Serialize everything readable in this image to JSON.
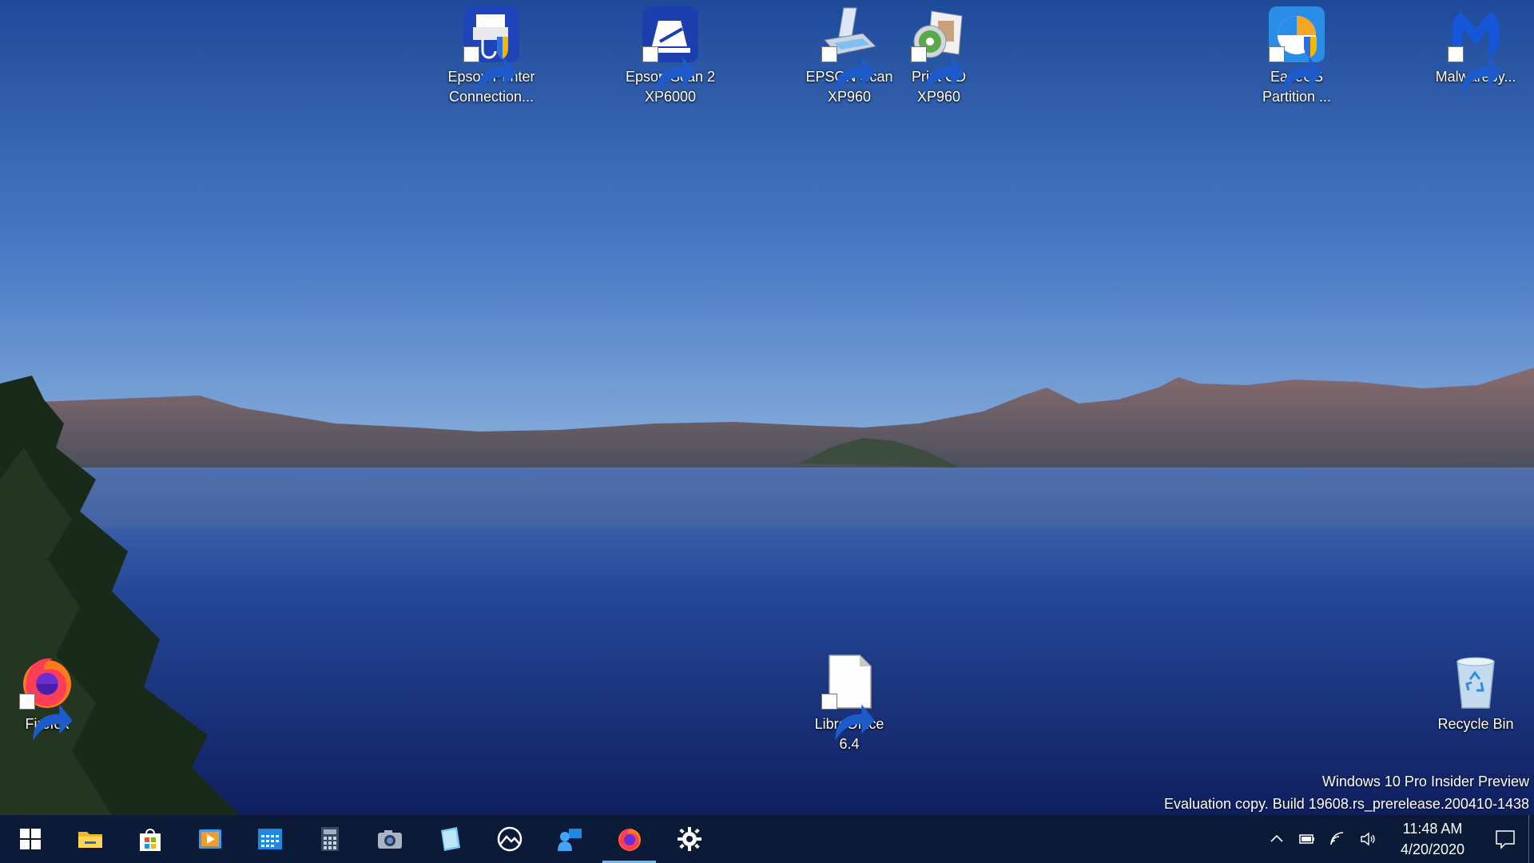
{
  "desktop_icons": {
    "epson_printer": {
      "label": "Epson Printer\nConnection...",
      "icon": "epson-printer-connection-icon"
    },
    "epson_scan2": {
      "label": "Epson Scan 2\nXP6000",
      "icon": "epson-scan2-icon"
    },
    "epson_scan": {
      "label": "EPSON Scan\nXP960",
      "icon": "epson-scan-icon"
    },
    "print_cd": {
      "label": "Print CD\nXP960",
      "icon": "print-cd-icon"
    },
    "easeus": {
      "label": "EaseUS\nPartition ...",
      "icon": "easeus-partition-icon"
    },
    "malwarebytes": {
      "label": "Malwareby...",
      "icon": "malwarebytes-icon"
    },
    "firefox": {
      "label": "Firefox",
      "icon": "firefox-icon"
    },
    "libreoffice": {
      "label": "LibreOffice\n6.4",
      "icon": "libreoffice-icon"
    },
    "recycle_bin": {
      "label": "Recycle Bin",
      "icon": "recycle-bin-icon"
    }
  },
  "watermark": {
    "line1": "Windows 10 Pro Insider Preview",
    "line2": "Evaluation copy. Build 19608.rs_prerelease.200410-1438"
  },
  "taskbar": {
    "pinned": [
      "start",
      "file-explorer",
      "microsoft-store",
      "media-player",
      "calendar",
      "calculator",
      "camera",
      "notepad",
      "photos",
      "people",
      "firefox",
      "settings"
    ],
    "active": "firefox",
    "clock": {
      "time": "11:48 AM",
      "date": "4/20/2020"
    }
  },
  "colors": {
    "taskbar_bg": "#0b1a36",
    "active_indicator": "#76b9ed"
  }
}
